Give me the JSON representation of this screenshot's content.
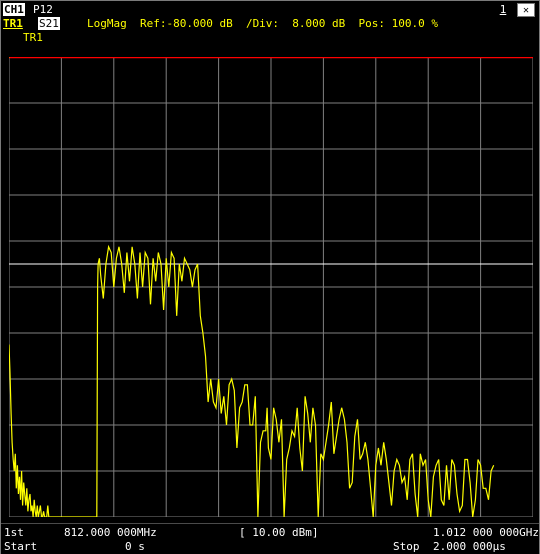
{
  "header": {
    "channel": "CH1",
    "port": "P12",
    "trace": "TR1",
    "param": "S21",
    "status": "LogMag  Ref:-80.000 dB  /Div:  8.000 dB  Pos: 100.0 %",
    "trace_label": "TR1",
    "window_number": "1",
    "close_glyph": "✕"
  },
  "footer": {
    "row1_left": "1st",
    "start_freq": "812.000 000MHz",
    "ref_power": "[ 10.00 dBm]",
    "stop_freq": "1.012 000 000GHz",
    "row2_left": "Start",
    "start_time": "0 s",
    "stop_label": "Stop",
    "stop_time": "2.000 000µs"
  },
  "colors": {
    "trace": "#ffff00",
    "grid": "#808080",
    "reference_line": "#ffffff",
    "top_border": "#ff0000"
  },
  "chart_data": {
    "type": "line",
    "title": "",
    "xlabel": "",
    "ylabel": "",
    "xlim": [
      0,
      2.0
    ],
    "x_unit": "µs",
    "ylim": [
      -160,
      -80
    ],
    "y_unit": "dB",
    "grid": true,
    "reference_level": -80,
    "series": [
      {
        "values_x": [
          0.0,
          0.004,
          0.008,
          0.012,
          0.016,
          0.02,
          0.024,
          0.028,
          0.032,
          0.036,
          0.04,
          0.044,
          0.048,
          0.052,
          0.056,
          0.06,
          0.064,
          0.068,
          0.072,
          0.076,
          0.08,
          0.084,
          0.088,
          0.092,
          0.096,
          0.1,
          0.104,
          0.108,
          0.112,
          0.116,
          0.12,
          0.124,
          0.128,
          0.132,
          0.136,
          0.14,
          0.144,
          0.148,
          0.152,
          0.156,
          0.16,
          0.164,
          0.168,
          0.172,
          0.176,
          0.18,
          0.184,
          0.188,
          0.192,
          0.196,
          0.2,
          0.204,
          0.208,
          0.212,
          0.216,
          0.22,
          0.224,
          0.228,
          0.232,
          0.236,
          0.24,
          0.244,
          0.248,
          0.252,
          0.256,
          0.26,
          0.264,
          0.27,
          0.28,
          0.29,
          0.3,
          0.31,
          0.32,
          0.33,
          0.335,
          0.338,
          0.34,
          0.345,
          0.35,
          0.36,
          0.37,
          0.38,
          0.39,
          0.4,
          0.41,
          0.42,
          0.43,
          0.44,
          0.45,
          0.46,
          0.47,
          0.48,
          0.49,
          0.5,
          0.51,
          0.52,
          0.53,
          0.54,
          0.55,
          0.56,
          0.57,
          0.58,
          0.59,
          0.6,
          0.61,
          0.62,
          0.63,
          0.64,
          0.65,
          0.66,
          0.67,
          0.68,
          0.69,
          0.7,
          0.71,
          0.72,
          0.73,
          0.74,
          0.75,
          0.76,
          0.77,
          0.78,
          0.79,
          0.8,
          0.81,
          0.82,
          0.83,
          0.84,
          0.85,
          0.86,
          0.87,
          0.88,
          0.89,
          0.9,
          0.91,
          0.92,
          0.93,
          0.94,
          0.95,
          0.96,
          0.97,
          0.98,
          0.985,
          0.99,
          1.0,
          1.01,
          1.02,
          1.03,
          1.04,
          1.05,
          1.06,
          1.07,
          1.08,
          1.09,
          1.1,
          1.11,
          1.12,
          1.13,
          1.14,
          1.15,
          1.16,
          1.17,
          1.18,
          1.19,
          1.2,
          1.21,
          1.22,
          1.23,
          1.24,
          1.25,
          1.26,
          1.27,
          1.28,
          1.29,
          1.3,
          1.31,
          1.32,
          1.33,
          1.34,
          1.35,
          1.36,
          1.37,
          1.38,
          1.39,
          1.4,
          1.41,
          1.42,
          1.43,
          1.44,
          1.45,
          1.46,
          1.47,
          1.48,
          1.49,
          1.5,
          1.51,
          1.52,
          1.53,
          1.54,
          1.55,
          1.56,
          1.57,
          1.58,
          1.59,
          1.6,
          1.61,
          1.62,
          1.63,
          1.64,
          1.65,
          1.66,
          1.67,
          1.68,
          1.69,
          1.7,
          1.71,
          1.72,
          1.73,
          1.74,
          1.75,
          1.76,
          1.77,
          1.78,
          1.79,
          1.8,
          1.81,
          1.82,
          1.83,
          1.84,
          1.85,
          1.86,
          1.87,
          1.88,
          1.89,
          1.9,
          1.91,
          1.92,
          1.93,
          1.94,
          1.95,
          1.96,
          1.97,
          1.98,
          1.99,
          2.0
        ],
        "values_y": [
          -130,
          -135,
          -142,
          -147,
          -150,
          -152,
          -149,
          -155,
          -151,
          -156,
          -153,
          -157,
          -152,
          -158,
          -154,
          -156,
          -158,
          -155,
          -159,
          -157,
          -156,
          -159,
          -158,
          -160,
          -157,
          -159,
          -160,
          -158,
          -160,
          -159,
          -158,
          -160,
          -160,
          -159,
          -160,
          -160,
          -160,
          -158,
          -160,
          -160,
          -160,
          -160,
          -160,
          -160,
          -160,
          -160,
          -160,
          -160,
          -160,
          -160,
          -160,
          -160,
          -160,
          -160,
          -160,
          -160,
          -160,
          -160,
          -160,
          -160,
          -160,
          -160,
          -160,
          -160,
          -160,
          -160,
          -160,
          -160,
          -160,
          -160,
          -160,
          -160,
          -160,
          -160,
          -160,
          -120,
          -116,
          -115,
          -118,
          -122,
          -116,
          -113,
          -114,
          -120,
          -115,
          -113,
          -116,
          -121,
          -114,
          -119,
          -113,
          -116,
          -122,
          -114,
          -120,
          -114,
          -115,
          -123,
          -115,
          -119,
          -114,
          -116,
          -124,
          -115,
          -120,
          -114,
          -115,
          -125,
          -116,
          -119,
          -115,
          -116,
          -117,
          -120,
          -117,
          -116,
          -125,
          -128,
          -132,
          -140,
          -136,
          -140,
          -141,
          -136,
          -142,
          -139,
          -144,
          -137,
          -136,
          -138,
          -148,
          -141,
          -140,
          -137,
          -137,
          -144,
          -144,
          -139,
          -160,
          -147,
          -145,
          -145,
          -141,
          -148,
          -150,
          -141,
          -143,
          -147,
          -143,
          -160,
          -150,
          -148,
          -145,
          -146,
          -141,
          -148,
          -152,
          -139,
          -142,
          -147,
          -141,
          -144,
          -160,
          -149,
          -150,
          -147,
          -144,
          -140,
          -149,
          -146,
          -143,
          -141,
          -143,
          -147,
          -155,
          -154,
          -146,
          -143,
          -150,
          -149,
          -147,
          -150,
          -155,
          -160,
          -151,
          -148,
          -151,
          -147,
          -150,
          -154,
          -158,
          -152,
          -150,
          -151,
          -154,
          -153,
          -157,
          -150,
          -149,
          -156,
          -160,
          -149,
          -151,
          -150,
          -157,
          -160,
          -153,
          -151,
          -150,
          -157,
          -158,
          -151,
          -157,
          -150,
          -151,
          -156,
          -159,
          -158,
          -150,
          -150,
          -154,
          -160,
          -157,
          -150,
          -151,
          -155,
          -155,
          -157,
          -152,
          -151
        ]
      }
    ]
  }
}
